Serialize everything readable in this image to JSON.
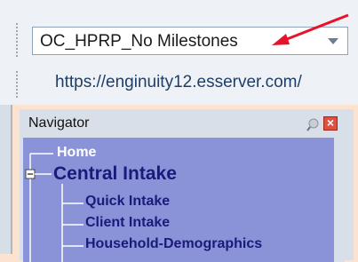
{
  "toolbar": {
    "combo_value": "OC_HPRP_No Milestones",
    "url": "https://enginuity12.esserver.com/"
  },
  "navigator": {
    "title": "Navigator",
    "tree": [
      {
        "label": "Home"
      },
      {
        "label": "Central Intake",
        "expanded": true,
        "children": [
          {
            "label": "Quick Intake"
          },
          {
            "label": "Client Intake"
          },
          {
            "label": "Household-Demographics"
          }
        ]
      }
    ]
  },
  "annotation": {
    "arrow_color": "#e5142a"
  },
  "colors": {
    "background": "#fbe3cf",
    "tree_bg": "#8a93d8",
    "tree_text": "#1a1a7a"
  }
}
